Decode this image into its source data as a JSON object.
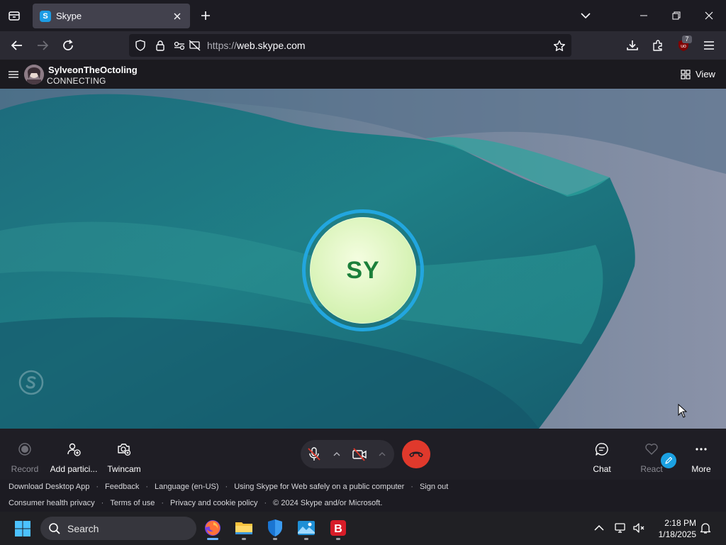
{
  "browser": {
    "tab": {
      "title": "Skype",
      "favicon_letter": "S"
    },
    "url": {
      "protocol": "https://",
      "host": "web.skype.com"
    },
    "extension_badge": "7"
  },
  "skype": {
    "contact_name": "SylveonTheOctoling",
    "call_status": "CONNECTING",
    "view_label": "View",
    "avatar_initials": "SY"
  },
  "controls": {
    "left": [
      {
        "label": "Record",
        "icon": "record-icon"
      },
      {
        "label": "Add partici...",
        "icon": "add-participant-icon"
      },
      {
        "label": "Twincam",
        "icon": "twincam-icon"
      }
    ],
    "right": [
      {
        "label": "Chat",
        "icon": "chat-icon"
      },
      {
        "label": "React",
        "icon": "heart-icon"
      },
      {
        "label": "More",
        "icon": "more-icon"
      }
    ]
  },
  "footer": {
    "row1": [
      "Download Desktop App",
      "Feedback",
      "Language (en-US)",
      "Using Skype for Web safely on a public computer",
      "Sign out"
    ],
    "row2": [
      "Consumer health privacy",
      "Terms of use",
      "Privacy and cookie policy",
      "© 2024 Skype and/or Microsoft."
    ]
  },
  "taskbar": {
    "search_label": "Search",
    "time": "2:18 PM",
    "date": "1/18/2025"
  },
  "colors": {
    "hangup": "#e0392c",
    "ring": "#22a6df",
    "skype_blue": "#1ba1e2",
    "initials": "#1b7f3a"
  }
}
